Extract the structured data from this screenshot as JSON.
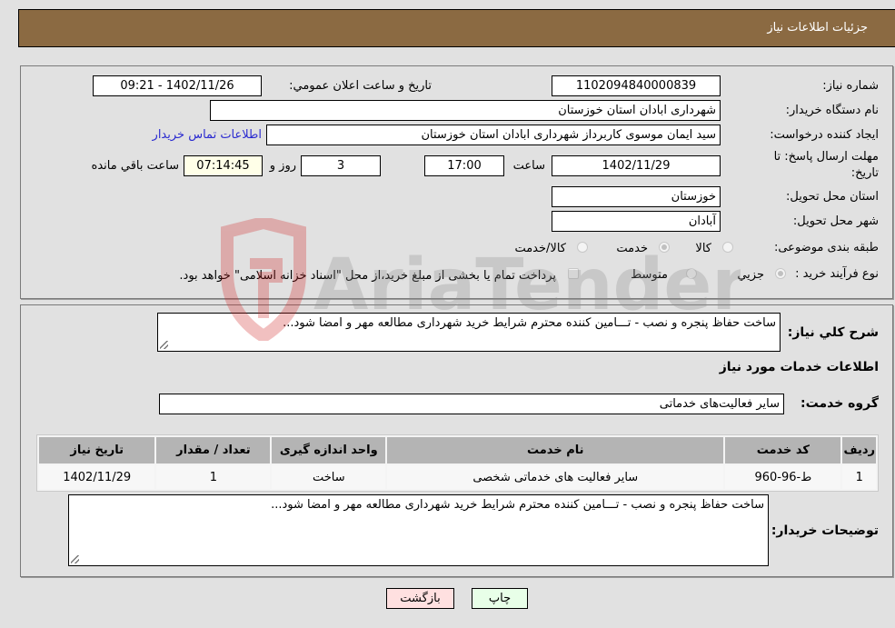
{
  "header": {
    "title": "جزئیات اطلاعات نیاز"
  },
  "form": {
    "need_number_label": "شماره نیاز:",
    "need_number": "1102094840000839",
    "announce_label": "تاريخ و ساعت اعلان عمومي:",
    "announce_value": "1402/11/26 - 09:21",
    "buyer_org_label": "نام دستگاه خريدار:",
    "buyer_org": "شهرداری ابادان استان خوزستان",
    "creator_label": "ايجاد کننده درخواست:",
    "creator": "سید ایمان موسوی کاربرداز شهرداری ابادان استان خوزستان",
    "contact_link": "اطلاعات تماس خريدار",
    "deadline_label_line1": "مهلت ارسال پاسخ: تا",
    "deadline_label_line2": "تاريخ:",
    "deadline_date": "1402/11/29",
    "time_label": "ساعت",
    "deadline_time": "17:00",
    "days_value": "3",
    "days_label": "روز و",
    "remaining_time": "07:14:45",
    "remaining_label": "ساعت باقي مانده",
    "province_label": "استان محل تحويل:",
    "province": "خوزستان",
    "city_label": "شهر محل تحويل:",
    "city": "آبادان",
    "category_label": "طبقه بندی موضوعی:",
    "category_options": [
      {
        "label": "کالا",
        "selected": false
      },
      {
        "label": "خدمت",
        "selected": true
      },
      {
        "label": "کالا/خدمت",
        "selected": false
      }
    ],
    "process_label": "نوع فرآیند خريد :",
    "process_options": [
      {
        "label": "جزيي",
        "selected": true
      },
      {
        "label": "متوسط",
        "selected": false
      }
    ],
    "treasury_checkbox_label": "پرداخت تمام يا بخشی از مبلغ خريد،از محل \"اسناد خزانه اسلامی\" خواهد بود.",
    "treasury_checked": false
  },
  "details": {
    "general_desc_label": "شرح کلي نياز:",
    "general_desc": "ساخت حفاظ پنجره و نصب - تـــامین کننده محترم شرایط خرید شهرداری مطالعه مهر و امضا شود...",
    "services_heading": "اطلاعات خدمات مورد نياز",
    "service_group_label": "گروه خدمت:",
    "service_group": "ساير فعاليت‌هاى خدماتى",
    "table": {
      "headers": [
        "رديف",
        "کد خدمت",
        "نام خدمت",
        "واحد اندازه گيری",
        "تعداد / مقدار",
        "تاريخ نياز"
      ],
      "rows": [
        [
          "1",
          "ط-96-960",
          "ساير فعاليت های خدماتی شخصی",
          "ساخت",
          "1",
          "1402/11/29"
        ]
      ]
    },
    "buyer_notes_label": "توضيحات خريدار:",
    "buyer_notes": "ساخت حفاظ پنجره و نصب - تـــامین کننده محترم شرایط خرید شهرداری مطالعه مهر و امضا شود..."
  },
  "buttons": {
    "back": "بازگشت",
    "print": "چاپ"
  },
  "watermark": {
    "text": "AriaTender.neT"
  },
  "colors": {
    "header_bg": "#8b6a42",
    "back_bg": "#ffe0e0",
    "print_bg": "#e8ffe8",
    "link": "#2b2bd0"
  }
}
